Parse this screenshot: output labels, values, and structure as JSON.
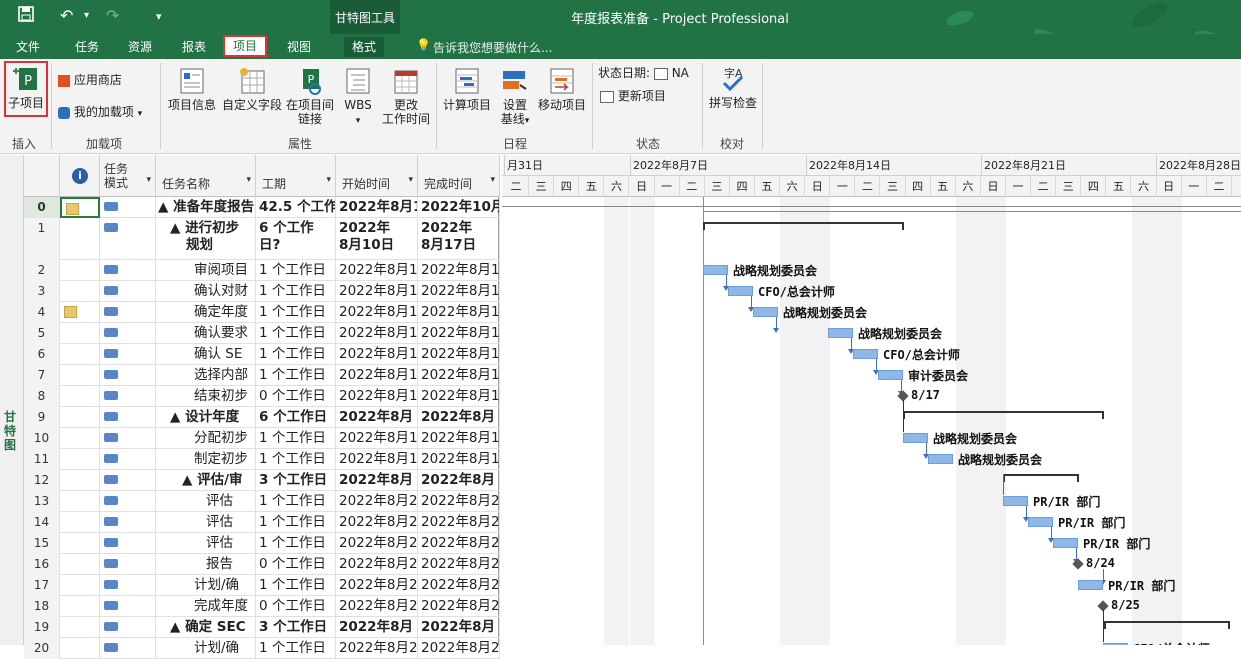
{
  "window": {
    "title": "年度报表准备 - Project Professional",
    "context_tool": "甘特图工具"
  },
  "tabs": [
    "文件",
    "任务",
    "资源",
    "报表",
    "项目",
    "视图",
    "格式"
  ],
  "tell_me": "告诉我您想要做什么...",
  "ribbon": {
    "insert": {
      "subproject": "子项目",
      "group": "插入"
    },
    "addins": {
      "store": "应用商店",
      "my_addins": "我的加载项",
      "group": "加载项"
    },
    "properties": {
      "project_info": "项目信息",
      "custom_fields": "自定义字段",
      "links_line1": "在项目间",
      "links_line2": "链接",
      "wbs": "WBS",
      "change_time_line1": "更改",
      "change_time_line2": "工作时间",
      "group": "属性"
    },
    "schedule": {
      "calc": "计算项目",
      "baseline_line1": "设置",
      "baseline_line2": "基线",
      "move": "移动项目",
      "group": "日程"
    },
    "status": {
      "status_date_label": "状态日期:",
      "status_date_value": "NA",
      "update": "更新项目",
      "group": "状态"
    },
    "proofing": {
      "spell": "拼写检查",
      "group": "校对"
    }
  },
  "sidebar_label": "甘特图",
  "columns": {
    "mode_line1": "任务",
    "mode_line2": "模式",
    "name": "任务名称",
    "duration": "工期",
    "start": "开始时间",
    "finish": "完成时间"
  },
  "timescale": {
    "weeks": [
      "月31日",
      "2022年8月7日",
      "2022年8月14日",
      "2022年8月21日",
      "2022年8月28日"
    ],
    "days": [
      "二",
      "三",
      "四",
      "五",
      "六",
      "日",
      "一",
      "二",
      "三",
      "四",
      "五",
      "六",
      "日",
      "一",
      "二",
      "三",
      "四",
      "五",
      "六",
      "日",
      "一",
      "二",
      "三",
      "四",
      "五",
      "六",
      "日",
      "一",
      "二"
    ]
  },
  "tasks": [
    {
      "id": "0",
      "name": "▲ 准备年度报告",
      "dur": "42.5 个工作",
      "start": "2022年8月1",
      "finish": "2022年10月",
      "bold": true,
      "indent": 0,
      "note": true
    },
    {
      "id": "1",
      "name": "▲ 进行初步规划",
      "dur": "6 个工作日?",
      "start": "2022年8月10日",
      "finish": "2022年8月17日",
      "bold": true,
      "indent": 1,
      "tall": true,
      "dur1": "6 个工作",
      "dur2": "日?",
      "start1": "2022年",
      "start2": "8月10日",
      "finish1": "2022年",
      "finish2": "8月17日",
      "name1": "进行初步",
      "name2": "规划"
    },
    {
      "id": "2",
      "name": "审阅项目",
      "dur": "1 个工作日",
      "start": "2022年8月1",
      "finish": "2022年8月1",
      "indent": 3
    },
    {
      "id": "3",
      "name": "确认对财",
      "dur": "1 个工作日",
      "start": "2022年8月1",
      "finish": "2022年8月1",
      "indent": 3
    },
    {
      "id": "4",
      "name": "确定年度",
      "dur": "1 个工作日",
      "start": "2022年8月1",
      "finish": "2022年8月1",
      "indent": 3,
      "note": true
    },
    {
      "id": "5",
      "name": "确认要求",
      "dur": "1 个工作日",
      "start": "2022年8月1",
      "finish": "2022年8月1",
      "indent": 3
    },
    {
      "id": "6",
      "name": "确认 SE",
      "dur": "1 个工作日",
      "start": "2022年8月1",
      "finish": "2022年8月1",
      "indent": 3
    },
    {
      "id": "7",
      "name": "选择内部",
      "dur": "1 个工作日",
      "start": "2022年8月1",
      "finish": "2022年8月1",
      "indent": 3
    },
    {
      "id": "8",
      "name": "结束初步",
      "dur": "0 个工作日",
      "start": "2022年8月1",
      "finish": "2022年8月1",
      "indent": 3
    },
    {
      "id": "9",
      "name": "▲ 设计年度",
      "dur": "6 个工作日",
      "start": "2022年8月",
      "finish": "2022年8月",
      "bold": true,
      "indent": 1
    },
    {
      "id": "10",
      "name": "分配初步",
      "dur": "1 个工作日",
      "start": "2022年8月1",
      "finish": "2022年8月1",
      "indent": 3
    },
    {
      "id": "11",
      "name": "制定初步",
      "dur": "1 个工作日",
      "start": "2022年8月1",
      "finish": "2022年8月1",
      "indent": 3
    },
    {
      "id": "12",
      "name": "▲ 评估/审",
      "dur": "3 个工作日",
      "start": "2022年8月",
      "finish": "2022年8月",
      "bold": true,
      "indent": 2
    },
    {
      "id": "13",
      "name": "评估",
      "dur": "1 个工作日",
      "start": "2022年8月2",
      "finish": "2022年8月2",
      "indent": 4
    },
    {
      "id": "14",
      "name": "评估",
      "dur": "1 个工作日",
      "start": "2022年8月2",
      "finish": "2022年8月2",
      "indent": 4
    },
    {
      "id": "15",
      "name": "评估",
      "dur": "1 个工作日",
      "start": "2022年8月2",
      "finish": "2022年8月2",
      "indent": 4
    },
    {
      "id": "16",
      "name": "报告",
      "dur": "0 个工作日",
      "start": "2022年8月2",
      "finish": "2022年8月2",
      "indent": 4
    },
    {
      "id": "17",
      "name": "计划/确",
      "dur": "1 个工作日",
      "start": "2022年8月2",
      "finish": "2022年8月2",
      "indent": 3
    },
    {
      "id": "18",
      "name": "完成年度",
      "dur": "0 个工作日",
      "start": "2022年8月2",
      "finish": "2022年8月2",
      "indent": 3
    },
    {
      "id": "19",
      "name": "▲ 确定 SEC",
      "dur": "3 个工作日",
      "start": "2022年8月",
      "finish": "2022年8月",
      "bold": true,
      "indent": 1
    },
    {
      "id": "20",
      "name": "计划/确",
      "dur": "1 个工作日",
      "start": "2022年8月2",
      "finish": "2022年8月2",
      "indent": 3
    }
  ],
  "gantt_labels": {
    "t2": "战略规划委员会",
    "t3": "CFO/总会计师",
    "t4": "战略规划委员会",
    "t5": "战略规划委员会",
    "t6": "CFO/总会计师",
    "t7": "审计委员会",
    "t8": "8/17",
    "t10": "战略规划委员会",
    "t11": "战略规划委员会",
    "t13": "PR/IR 部门",
    "t14": "PR/IR 部门",
    "t15": "PR/IR 部门",
    "t16": "8/24",
    "t17": "PR/IR 部门",
    "t18": "8/25",
    "t20": "CFO/总会计师"
  },
  "colors": {
    "brand": "#217346",
    "bar": "#8fb8e8",
    "accent_red": "#e03030"
  }
}
